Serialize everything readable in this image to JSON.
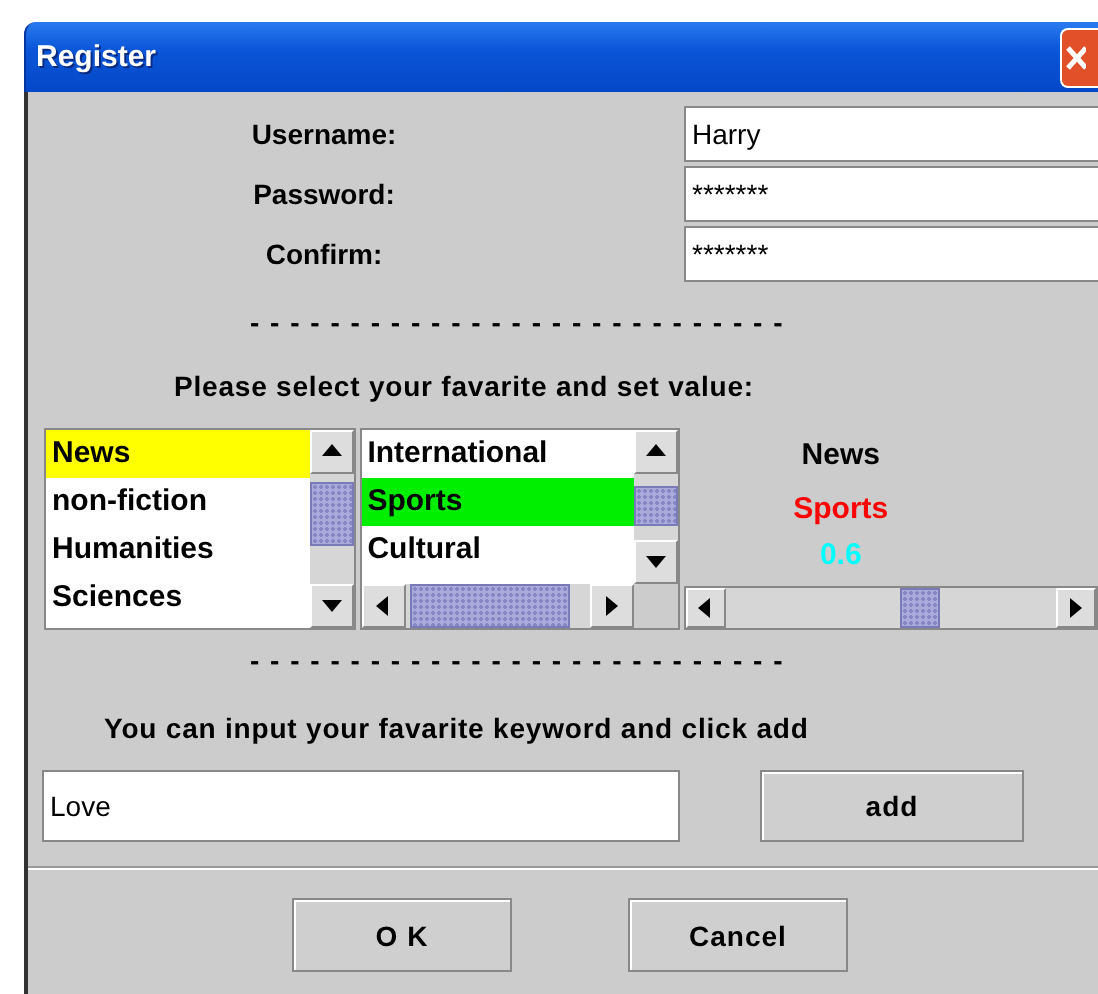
{
  "window": {
    "title": "Register"
  },
  "form": [
    {
      "label": "Username:",
      "value": "Harry"
    },
    {
      "label": "Password:",
      "value": "*******"
    },
    {
      "label": "Confirm:",
      "value": "*******"
    }
  ],
  "separator_1": "---------------------------",
  "prompt": "Please select your favarite and set value:",
  "category_list": {
    "items": [
      {
        "label": "News",
        "selected": true
      },
      {
        "label": "non-fiction",
        "selected": false
      },
      {
        "label": "Humanities",
        "selected": false
      },
      {
        "label": "Sciences",
        "selected": false
      }
    ]
  },
  "subcategory_list": {
    "items": [
      {
        "label": "International",
        "selected": false
      },
      {
        "label": "Sports",
        "selected": true
      },
      {
        "label": "Cultural",
        "selected": false
      }
    ]
  },
  "selection_display": {
    "category": "News",
    "subcategory": "Sports",
    "value": "0.6"
  },
  "value_slider": {
    "level": 0.6
  },
  "separator_2": "---------------------------",
  "keyword_prompt": "You can input your favarite keyword and click add",
  "keyword_field": {
    "value": "Love"
  },
  "add_button": "add",
  "buttons": [
    "O K",
    "Cancel"
  ]
}
